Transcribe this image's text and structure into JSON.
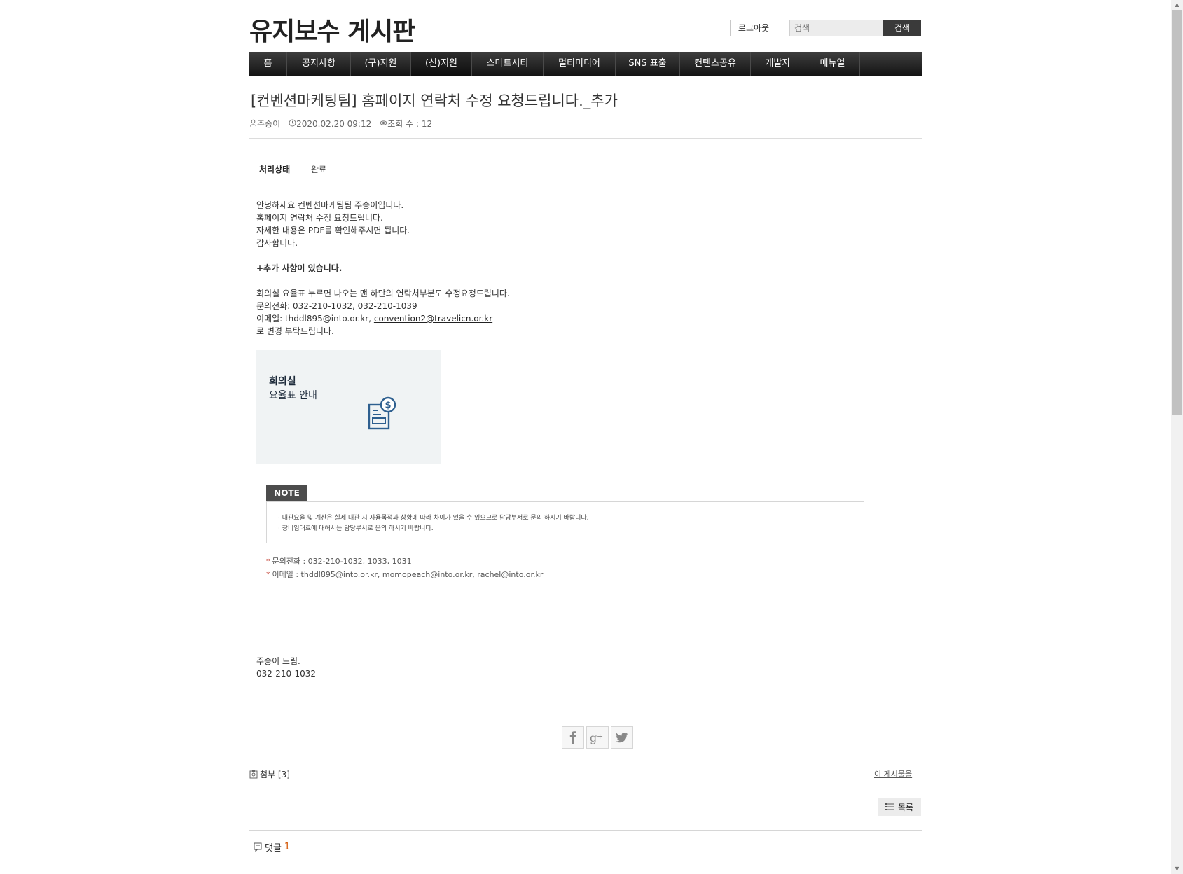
{
  "header": {
    "site_title": "유지보수 게시판",
    "logout_label": "로그아웃",
    "search_placeholder": "검색",
    "search_button": "검색"
  },
  "nav": {
    "items": [
      {
        "label": "홈"
      },
      {
        "label": "공지사항"
      },
      {
        "label": "(구)지원"
      },
      {
        "label": "(신)지원"
      },
      {
        "label": "스마트시티"
      },
      {
        "label": "멀티미디어"
      },
      {
        "label": "SNS 표출"
      },
      {
        "label": "컨텐츠공유"
      },
      {
        "label": "개발자"
      },
      {
        "label": "매뉴얼"
      }
    ],
    "active_index": 3
  },
  "post": {
    "title": "[컨벤션마케팅팀] 홈페이지 연락처 수정 요청드립니다._추가",
    "author": "주송이",
    "datetime": "2020.02.20 09:12",
    "views": "조회 수 : 12",
    "status_label": "처리상태",
    "status_value": "완료",
    "body": {
      "lines": [
        "안녕하세요 컨벤션마케팅팀 주송이입니다.",
        "홈페이지 연락처 수정 요청드립니다.",
        "자세한 내용은 PDF를 확인해주시면 됩니다.",
        "감사합니다."
      ],
      "additional_heading": "+추가 사항이 있습니다.",
      "additional_lines": [
        "회의실 요율표 누르면 나오는 맨 하단의 연락처부분도 수정요청드립니다.",
        "문의전화: 032-210-1032, 032-210-1039"
      ],
      "email_prefix": "이메일: thddl895@into.or.kr, ",
      "email_link": "convention2@travelicn.or.kr",
      "closing_line": "로 변경 부탁드립니다."
    },
    "card": {
      "title": "회의실",
      "subtitle": "요율표 안내",
      "icon": "price-document-icon"
    },
    "note": {
      "tag": "NOTE",
      "lines": [
        "· 대관요율 및 계산은 실제 대관 시 사용목적과 상황에 따라 차이가 있을 수 있으므로 담당부서로 문의 하시기 바랍니다.",
        "· 장비임대료에 대해서는 담당부서로 문의 하시기 바랍니다."
      ]
    },
    "contacts": [
      "문의전화 : 032-210-1032, 1033, 1031",
      "이메일 : thddl895@into.or.kr, momopeach@into.or.kr, rachel@into.or.kr"
    ],
    "signature": [
      "주송이 드림.",
      "032-210-1032"
    ]
  },
  "share": [
    "facebook-icon",
    "google-plus-icon",
    "twitter-icon"
  ],
  "attachments_label": "첨부 [3]",
  "this_post_label": "이 게시물을",
  "list_button": "목록",
  "comments": {
    "label": "댓글",
    "count": "1"
  },
  "colors": {
    "nav_bg": "#1e1e1e",
    "note_tag": "#4c4c4c",
    "accent_star": "#c0392b",
    "comment_count": "#d35400",
    "card_bg": "#f0f3f4",
    "icon_blue": "#2e5f8f"
  }
}
